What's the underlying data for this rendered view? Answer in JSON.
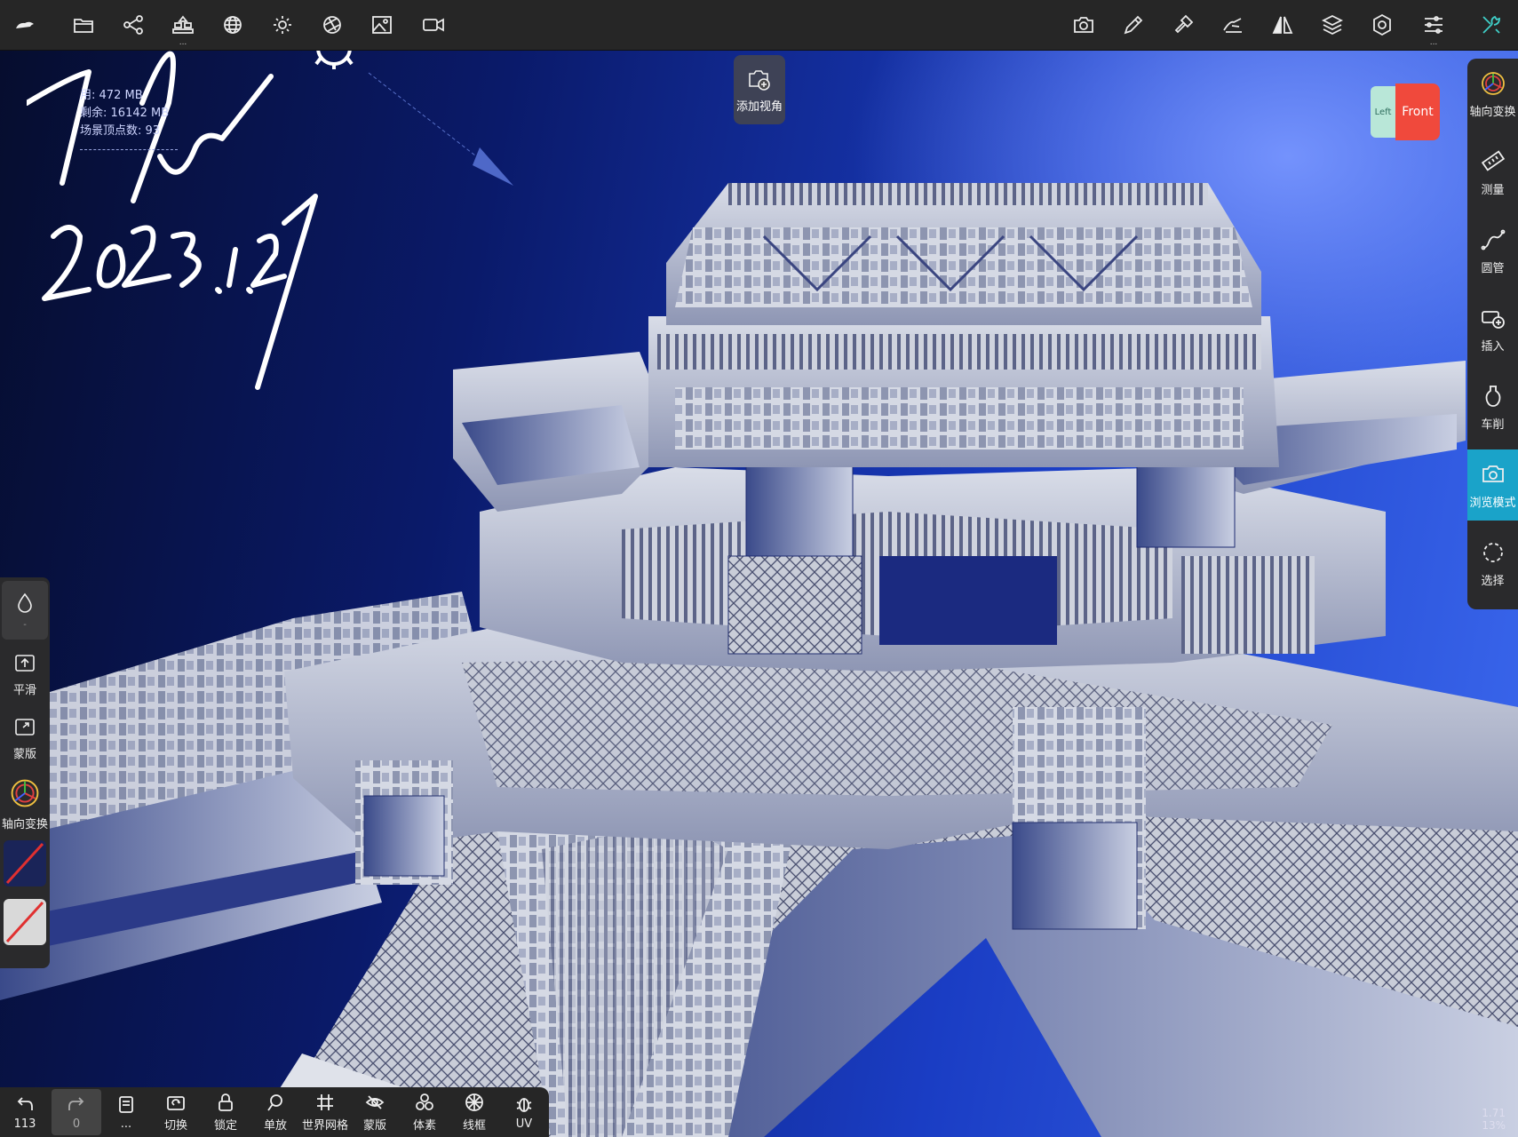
{
  "topbar": {
    "left_icons": [
      "app-logo-icon",
      "folder-icon",
      "node-graph-icon",
      "scene-icon",
      "sphere-icon",
      "sun-icon",
      "aperture-icon",
      "image-icon",
      "video-icon"
    ],
    "right_icons": [
      "camera-icon",
      "pen-icon",
      "brush-icon",
      "grab-icon",
      "symmetry-icon",
      "layers-icon",
      "gear-icon",
      "sliders-icon",
      "tools-icon"
    ],
    "tool_color": "#3fd0c9"
  },
  "hud": {
    "memory_used": "472 MB",
    "memory_free": "16142 MB",
    "used_prefix": "用:",
    "free_prefix": "剩余:",
    "vertex_prefix": "场景顶点数:",
    "vertex_value": "93"
  },
  "signature": {
    "date": "2023.1.27"
  },
  "add_view": {
    "label": "添加视角"
  },
  "view_cube": {
    "left": "Left",
    "front": "Front"
  },
  "right_panel": {
    "items": [
      {
        "label": "轴向变换",
        "icon": "gizmo-icon"
      },
      {
        "label": "测量",
        "icon": "ruler-icon"
      },
      {
        "label": "圆管",
        "icon": "tube-icon"
      },
      {
        "label": "插入",
        "icon": "insert-icon"
      },
      {
        "label": "车削",
        "icon": "lathe-icon"
      },
      {
        "label": "浏览模式",
        "icon": "camera-icon"
      },
      {
        "label": "选择",
        "icon": "lasso-icon"
      }
    ],
    "active_index": 5,
    "active_color": "#1aa3c9"
  },
  "left_panel": {
    "top_label": "-",
    "items": [
      {
        "label": "平滑",
        "icon": "smooth-icon"
      },
      {
        "label": "蒙版",
        "icon": "mask-icon"
      },
      {
        "label": "轴向变换",
        "icon": "gizmo-icon"
      }
    ]
  },
  "bottombar": {
    "items": [
      {
        "label": "113",
        "icon": "undo-icon"
      },
      {
        "label": "0",
        "icon": "redo-icon"
      },
      {
        "label": "...",
        "icon": "history-icon"
      },
      {
        "label": "切换",
        "icon": "switch-icon"
      },
      {
        "label": "锁定",
        "icon": "lock-icon"
      },
      {
        "label": "单放",
        "icon": "solo-icon"
      },
      {
        "label": "世界网格",
        "icon": "grid-icon"
      },
      {
        "label": "蒙版",
        "icon": "mask-eye-icon"
      },
      {
        "label": "体素",
        "icon": "voxel-icon"
      },
      {
        "label": "线框",
        "icon": "wireframe-icon"
      },
      {
        "label": "UV",
        "icon": "uv-icon"
      }
    ],
    "active_index": 1
  },
  "zoom": {
    "value": "1.71",
    "percent": "13%"
  }
}
